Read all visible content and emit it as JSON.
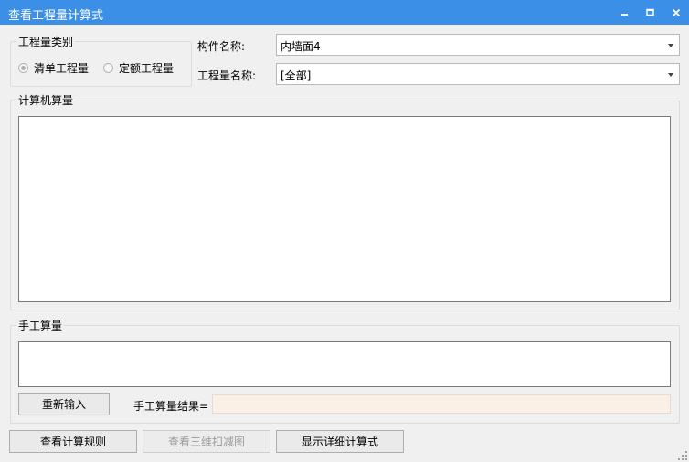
{
  "window": {
    "title": "查看工程量计算式"
  },
  "quantity_type": {
    "label": "工程量类别",
    "options": [
      {
        "label": "清单工程量",
        "selected": true
      },
      {
        "label": "定额工程量",
        "selected": false
      }
    ]
  },
  "component": {
    "label": "构件名称:",
    "value": "内墙面4"
  },
  "quantity_name": {
    "label": "工程量名称:",
    "value": "[全部]"
  },
  "computer_calc": {
    "label": "计算机算量",
    "content": ""
  },
  "manual_calc": {
    "label": "手工算量",
    "content": "",
    "reinput_button": "重新输入",
    "result_label": "手工算量结果=",
    "result_value": ""
  },
  "footer": {
    "view_rules_button": "查看计算规则",
    "view_3d_button": "查看三维扣减图",
    "show_detail_button": "显示详细计算式"
  },
  "colors": {
    "titlebar": "#3c8fe6",
    "result_field_bg": "#faf0e6"
  }
}
